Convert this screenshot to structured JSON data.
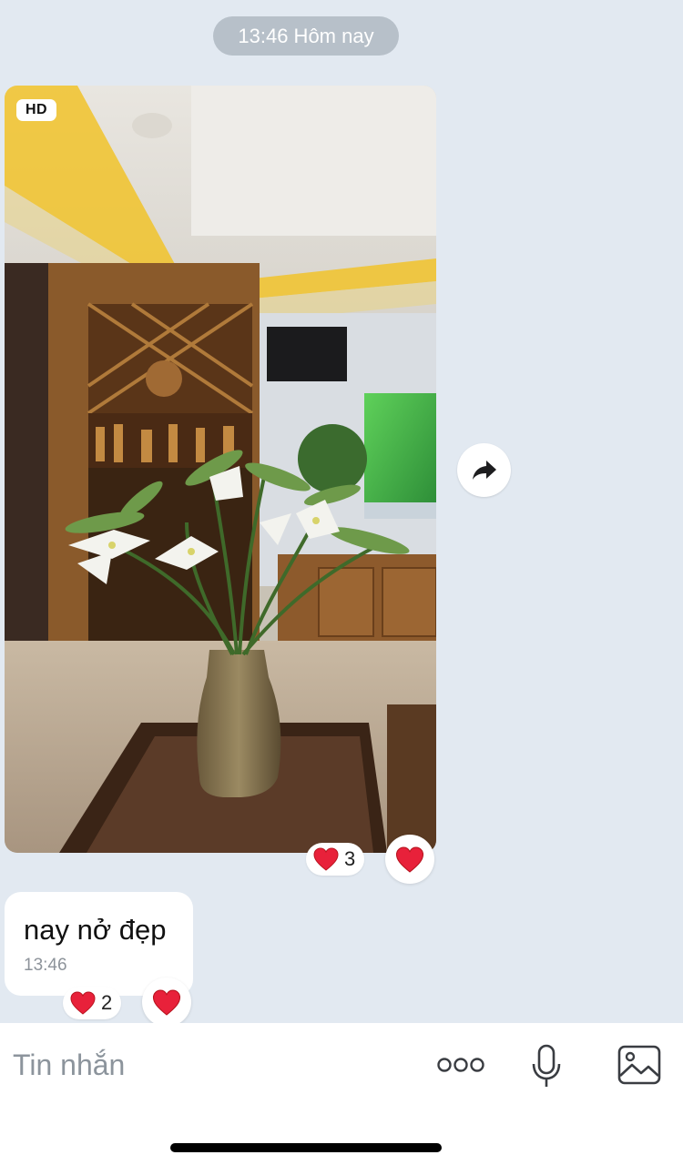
{
  "date_pill": "13:46 Hôm nay",
  "photo_message": {
    "badge": "HD",
    "reaction_emoji": "heart",
    "reaction_count": "3"
  },
  "text_message": {
    "text": "nay nở đẹp",
    "time": "13:46",
    "reaction_emoji": "heart",
    "reaction_count": "2"
  },
  "composer": {
    "placeholder": "Tin nhắn"
  },
  "icons": {
    "share": "share-arrow-icon",
    "react": "heart-icon",
    "more": "more-dots-icon",
    "mic": "microphone-icon",
    "gallery": "image-gallery-icon"
  },
  "colors": {
    "background": "#e2e9f1",
    "heart": "#e8213a",
    "date_pill": "#b7c0c9"
  }
}
